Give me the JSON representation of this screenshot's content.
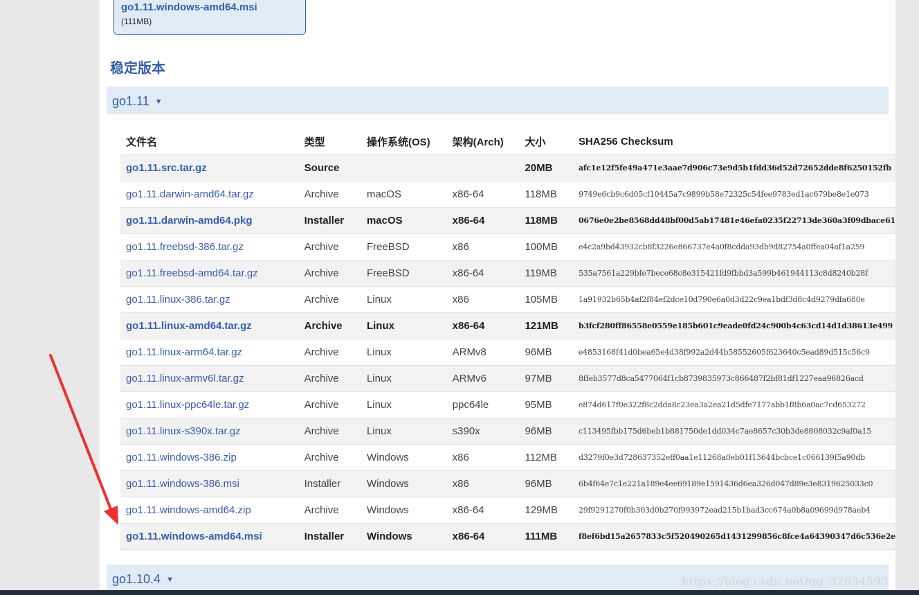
{
  "featured": {
    "filename": "go1.11.windows-amd64.msi",
    "size": "(111MB)"
  },
  "stable_heading": "稳定版本",
  "versions": [
    {
      "label": "go1.11",
      "caret": "▼"
    },
    {
      "label": "go1.10.4",
      "caret": "▼"
    }
  ],
  "table": {
    "headers": [
      "文件名",
      "类型",
      "操作系统(OS)",
      "架构(Arch)",
      "大小",
      "SHA256 Checksum"
    ],
    "rows": [
      [
        "go1.11.src.tar.gz",
        "Source",
        "",
        "",
        "20MB",
        "afc1e12f5fe49a471e3aae7d906c73e9d5b1fdd36d52d72652dde8f6250152fb"
      ],
      [
        "go1.11.darwin-amd64.tar.gz",
        "Archive",
        "macOS",
        "x86-64",
        "118MB",
        "9749e6cb9c6d05cf10445a7c9899b58e72325c54fee9783ed1ac679be8e1e073"
      ],
      [
        "go1.11.darwin-amd64.pkg",
        "Installer",
        "macOS",
        "x86-64",
        "118MB",
        "0676e0e2be8568dd48bf00d5ab17481e46efa0235f22713de360a3f09dbace61"
      ],
      [
        "go1.11.freebsd-386.tar.gz",
        "Archive",
        "FreeBSD",
        "x86",
        "100MB",
        "e4c2a9bd43932cb8f3226e866737e4a0f8cdda93db9d82754a0ffea04af1a259"
      ],
      [
        "go1.11.freebsd-amd64.tar.gz",
        "Archive",
        "FreeBSD",
        "x86-64",
        "119MB",
        "535a7561a229bfe7bece68c8e315421fd9fbbd3a599b461944113c8d8240b28f"
      ],
      [
        "go1.11.linux-386.tar.gz",
        "Archive",
        "Linux",
        "x86",
        "105MB",
        "1a91932b65b4af2f84ef2dce10d790e6a0d3d22c9ea1bdf3d8c4d9279dfa680e"
      ],
      [
        "go1.11.linux-amd64.tar.gz",
        "Archive",
        "Linux",
        "x86-64",
        "121MB",
        "b3fcf280ff86558e0559e185b601c9eade0fd24c900b4c63cd14d1d38613e499"
      ],
      [
        "go1.11.linux-arm64.tar.gz",
        "Archive",
        "Linux",
        "ARMv8",
        "96MB",
        "e4853168f41d0bea65e4d38f992a2d44b58552605f623640c5ead89d515c56c9"
      ],
      [
        "go1.11.linux-armv6l.tar.gz",
        "Archive",
        "Linux",
        "ARMv6",
        "97MB",
        "8ffeb3577d8ca5477064f1cb8739835973c866487f2bf81df1227eaa96826acd"
      ],
      [
        "go1.11.linux-ppc64le.tar.gz",
        "Archive",
        "Linux",
        "ppc64le",
        "95MB",
        "e874d617f0e322f8c2dda8c23ea3a2ea21d5dfe7177abb1f8b6a0ac7cd653272"
      ],
      [
        "go1.11.linux-s390x.tar.gz",
        "Archive",
        "Linux",
        "s390x",
        "96MB",
        "c113495fbb175d6beb1b881750de1dd034c7ae8657c30b3de8808032c9af0a15"
      ],
      [
        "go1.11.windows-386.zip",
        "Archive",
        "Windows",
        "x86",
        "112MB",
        "d3279f0e3d728637352eff0aa1e11268a0eb01f13644bcbce1c066139f5a90db"
      ],
      [
        "go1.11.windows-386.msi",
        "Installer",
        "Windows",
        "x86",
        "96MB",
        "6b4f64e7c1e221a189e4ee69189e1591436d6ea326d047d89e3e8319625033c0"
      ],
      [
        "go1.11.windows-amd64.zip",
        "Archive",
        "Windows",
        "x86-64",
        "129MB",
        "29f9291270f0b303d0b270f993972ead215b1bad3cc674a0b8a09699d978aeb4"
      ],
      [
        "go1.11.windows-amd64.msi",
        "Installer",
        "Windows",
        "x86-64",
        "111MB",
        "f8ef6bd15a2657833c5f520490265d1431299856c8fce4a64390347d6c536e2e"
      ]
    ],
    "highlighted_rows": [
      0,
      2,
      6,
      14
    ]
  },
  "watermark": "https://blog.csdn.net/qq_32034593",
  "colors": {
    "accent": "#375eab",
    "arrow": "#ee3030",
    "version_bar": "#e0ebf5"
  }
}
